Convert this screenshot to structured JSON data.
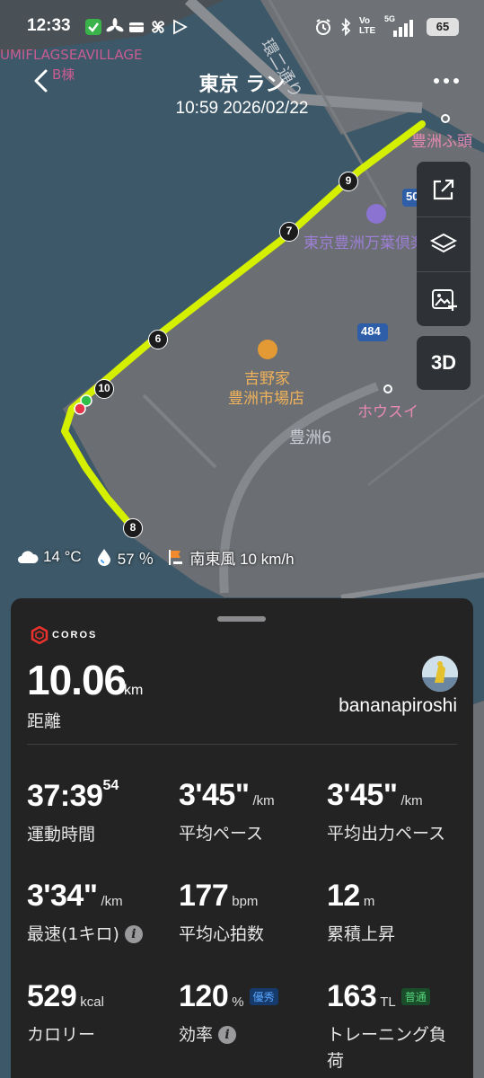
{
  "status_bar": {
    "time": "12:33",
    "battery": "65",
    "network": "5G",
    "volte": "Vo LTE"
  },
  "header": {
    "title": "東京 ラン",
    "datetime": "10:59 2026/02/22",
    "back_icon": "chevron-left-icon",
    "more_icon": "more-dots-icon"
  },
  "map": {
    "labels": {
      "village": "UMIFLAGSEAVILLAGE",
      "village_sub": "B棟",
      "street": "環二通り",
      "toyosu_futo": "豊洲ふ頭",
      "club": "東京豊洲万葉倶楽",
      "restaurant_line1": "吉野家",
      "restaurant_line2": "豊洲市場店",
      "hokusui": "ホウスイ",
      "toyosu6": "豊洲6",
      "road_484": "484",
      "road_50": "50"
    },
    "route_color": "#d4f000",
    "markers": [
      "9",
      "7",
      "6",
      "10",
      "8"
    ]
  },
  "tools": {
    "share_icon": "share-icon",
    "layers_icon": "layers-icon",
    "add_photo_icon": "add-photo-icon",
    "label_3d": "3D"
  },
  "weather": {
    "temperature": "14 °C",
    "humidity": "57 ％",
    "wind": "南東風 10 km/h"
  },
  "panel": {
    "brand": "COROS",
    "distance": {
      "value": "10.06",
      "unit": "km",
      "label": "距離"
    },
    "username": "bananapiroshi",
    "stats": {
      "duration": {
        "value": "37:39",
        "sup": "54",
        "label": "運動時間"
      },
      "avg_pace": {
        "value": "3'45\"",
        "unit": "/km",
        "label": "平均ペース"
      },
      "avg_power_pace": {
        "value": "3'45\"",
        "unit": "/km",
        "label": "平均出力ペース"
      },
      "fastest": {
        "value": "3'34\"",
        "unit": "/km",
        "label": "最速(1キロ)"
      },
      "avg_hr": {
        "value": "177",
        "unit": "bpm",
        "label": "平均心拍数"
      },
      "elevation": {
        "value": "12",
        "unit": "m",
        "label": "累積上昇"
      },
      "calories": {
        "value": "529",
        "unit": "kcal",
        "label": "カロリー"
      },
      "efficiency": {
        "value": "120",
        "unit": "%",
        "badge": "優秀",
        "label": "効率"
      },
      "training_load": {
        "value": "163",
        "unit": "TL",
        "badge": "普通",
        "label_line1": "トレーニング負",
        "label_line2": "荷"
      }
    }
  }
}
